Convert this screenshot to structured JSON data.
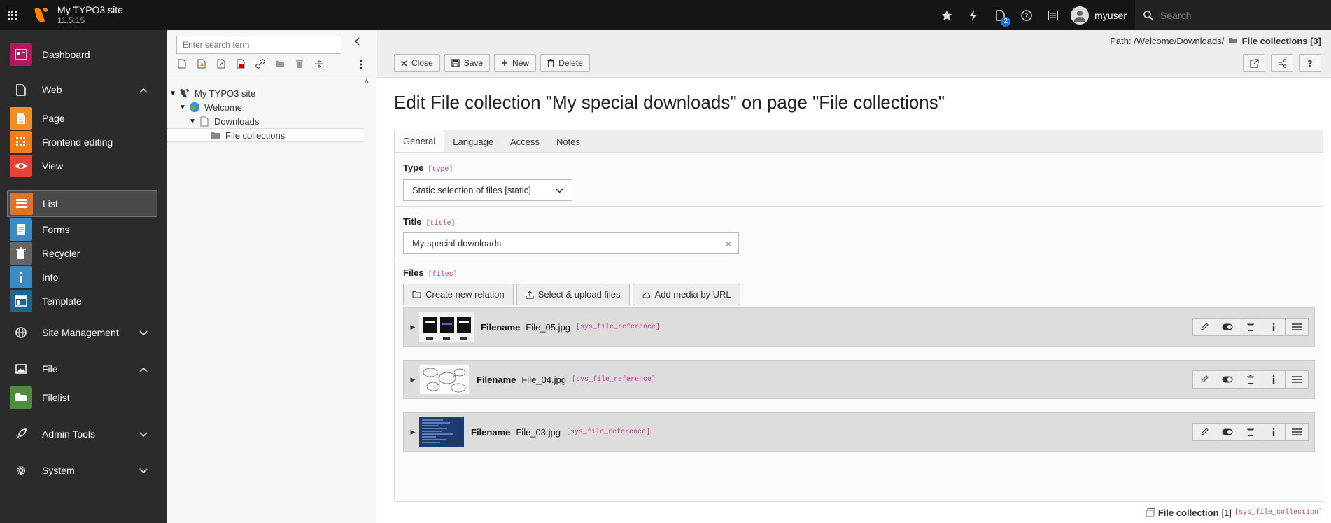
{
  "topbar": {
    "site_name": "My TYPO3 site",
    "version": "11.5.15",
    "user": "myuser",
    "search_placeholder": "Search",
    "badge_count": "2"
  },
  "modules": {
    "dashboard": "Dashboard",
    "web": "Web",
    "page": "Page",
    "frontend_editing": "Frontend editing",
    "view": "View",
    "list": "List",
    "forms": "Forms",
    "recycler": "Recycler",
    "info": "Info",
    "template": "Template",
    "site_management": "Site Management",
    "file": "File",
    "filelist": "Filelist",
    "admin_tools": "Admin Tools",
    "system": "System"
  },
  "tree": {
    "search_placeholder": "Enter search term",
    "nodes": [
      "My TYPO3 site",
      "Welcome",
      "Downloads",
      "File collections"
    ]
  },
  "docheader": {
    "path_label": "Path: /Welcome/Downloads/",
    "path_current": "File collections [3]",
    "close": "Close",
    "save": "Save",
    "new": "New",
    "delete": "Delete"
  },
  "page_title": "Edit File collection \"My special downloads\" on page \"File collections\"",
  "tabs": [
    "General",
    "Language",
    "Access",
    "Notes"
  ],
  "fields": {
    "type_label": "Type",
    "type_key": "[type]",
    "type_value": "Static selection of files [static]",
    "title_label": "Title",
    "title_key": "[title]",
    "title_value": "My special downloads",
    "files_label": "Files",
    "files_key": "[files]",
    "create_relation": "Create new relation",
    "select_upload": "Select & upload files",
    "add_media": "Add media by URL"
  },
  "files": [
    {
      "label": "Filename",
      "name": "File_05.jpg",
      "table": "[sys_file_reference]"
    },
    {
      "label": "Filename",
      "name": "File_04.jpg",
      "table": "[sys_file_reference]"
    },
    {
      "label": "Filename",
      "name": "File_03.jpg",
      "table": "[sys_file_reference]"
    }
  ],
  "footer": {
    "label": "File collection",
    "uid": "[1]",
    "table": "[sys_file_collection]"
  },
  "colors": {
    "topbar": "#151515",
    "module_menu": "#2b2b2b",
    "accent": "#ff8700",
    "record_key": "#c83c91"
  }
}
